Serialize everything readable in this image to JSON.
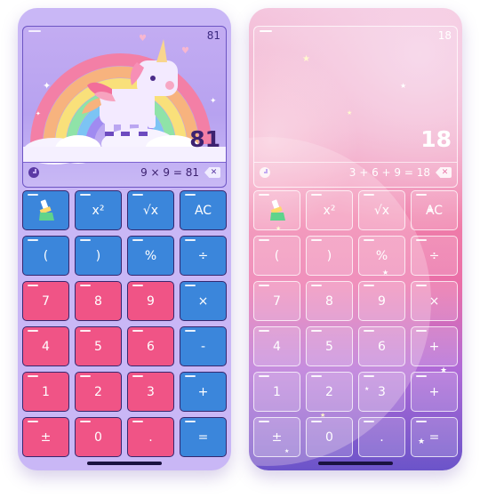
{
  "screens": [
    {
      "counter": "81",
      "result": "81",
      "expression": "9 × 9 = 81",
      "keys": [
        "",
        "x²",
        "√x",
        "AC",
        "(",
        ")",
        "%",
        "÷",
        "7",
        "8",
        "9",
        "×",
        "4",
        "5",
        "6",
        "-",
        "1",
        "2",
        "3",
        "+",
        "±",
        "0",
        ".",
        "="
      ]
    },
    {
      "counter": "18",
      "result": "18",
      "expression": "3 + 6 + 9 = 18",
      "keys": [
        "",
        "x²",
        "√x",
        "AC",
        "(",
        ")",
        "%",
        "÷",
        "7",
        "8",
        "9",
        "×",
        "4",
        "5",
        "6",
        "+",
        "1",
        "2",
        "3",
        "+",
        "±",
        "0",
        ".",
        "="
      ]
    }
  ],
  "icons": {
    "history": "clock-icon",
    "backspace": "backspace-icon",
    "theme": "paint-brush-icon"
  },
  "colors": {
    "left_blue_key": "#3b86db",
    "left_pink_key": "#f05486",
    "left_background": "#c9b7f6",
    "right_background": "#f07ea9"
  }
}
